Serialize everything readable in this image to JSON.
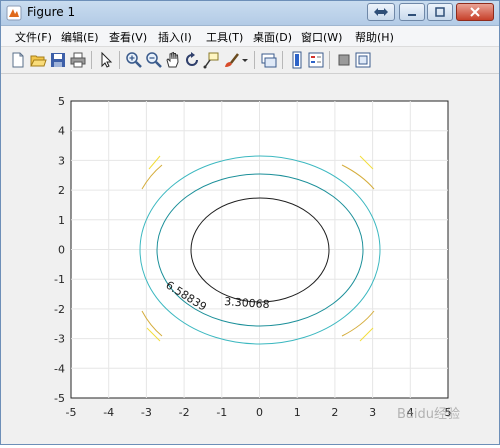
{
  "window": {
    "title": "Figure 1"
  },
  "menu": {
    "items": [
      "文件(F)",
      "编辑(E)",
      "查看(V)",
      "插入(I)",
      "工具(T)",
      "桌面(D)",
      "窗口(W)",
      "帮助(H)"
    ]
  },
  "toolbar": {
    "buttons": [
      "new-figure-icon",
      "open-file-icon",
      "save-icon",
      "print-icon",
      "edit-plot-icon",
      "zoom-in-icon",
      "zoom-out-icon",
      "pan-icon",
      "rotate-3d-icon",
      "data-cursor-icon",
      "brush-icon",
      "brush-dropdown-icon",
      "link-plot-icon",
      "colorbar-icon",
      "legend-icon",
      "hide-plot-tools-icon",
      "show-plot-tools-icon"
    ]
  },
  "chart_data": {
    "type": "contour",
    "title": "",
    "xlabel": "",
    "ylabel": "",
    "xlim": [
      -5,
      5
    ],
    "ylim": [
      -5,
      5
    ],
    "xticks": [
      "-5",
      "-4",
      "-3",
      "-2",
      "-1",
      "0",
      "1",
      "2",
      "3",
      "4",
      "5"
    ],
    "yticks": [
      "-5",
      "-4",
      "-3",
      "-2",
      "-1",
      "0",
      "1",
      "2",
      "3",
      "4",
      "5"
    ],
    "grid": true,
    "contour_labels": [
      "6.58839",
      "3.30068"
    ],
    "colors": {
      "inner": "#1f1f1f",
      "middle": "#1b8f99",
      "outer": "#3cb8c0",
      "corner_inner": "#d5ad3c",
      "corner_outer": "#f2dd3a"
    }
  },
  "watermark": "Baidu经验"
}
